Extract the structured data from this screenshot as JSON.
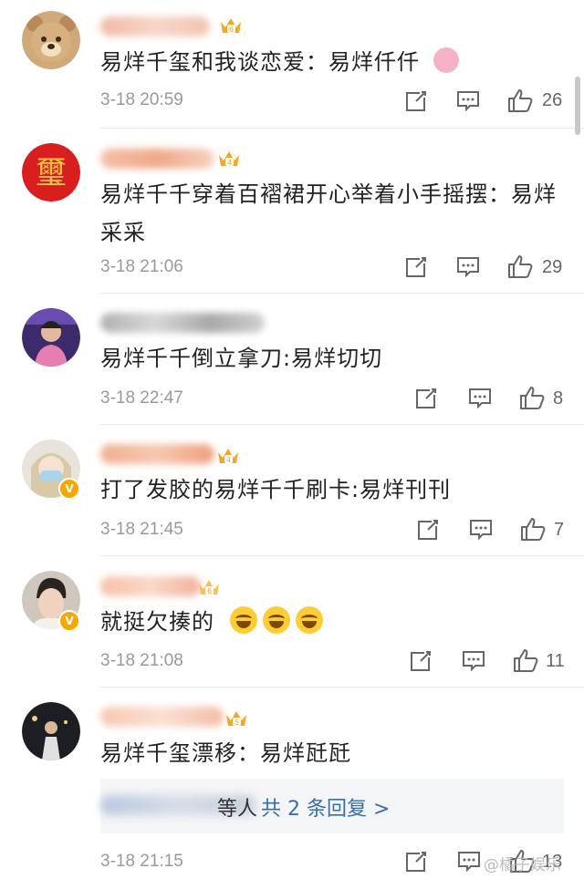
{
  "comments": [
    {
      "text": "易烊千玺和我谈恋爱：易烊仟仟",
      "time": "3-18 20:59",
      "likes": "26",
      "has_bird": true
    },
    {
      "text": "易烊千千穿着百褶裙开心举着小手摇摆：易烊采采",
      "time": "3-18 21:06",
      "likes": "29"
    },
    {
      "text": "易烊千千倒立拿刀:易烊切切",
      "time": "3-18 22:47",
      "likes": "8"
    },
    {
      "text": "打了发胶的易烊千千刷卡:易烊刊刊",
      "time": "3-18 21:45",
      "likes": "7"
    },
    {
      "text": "就挺欠揍的",
      "time": "3-18 21:08",
      "likes": "11",
      "emoji_count": 3
    },
    {
      "text": "易烊千玺漂移：易烊瓩瓩",
      "time": "3-18 21:15",
      "likes": "13"
    }
  ],
  "replies": {
    "suffix": "等人",
    "link": "共 2 条回复 >"
  },
  "watermark": "@橘子娱乐",
  "icons": [
    "share-icon",
    "comment-icon",
    "like-icon",
    "crown-icon",
    "verified-badge-icon"
  ],
  "colors": {
    "text": "#222222",
    "meta": "#999999",
    "link": "#3a6ea8",
    "badge": "#f7a800"
  }
}
